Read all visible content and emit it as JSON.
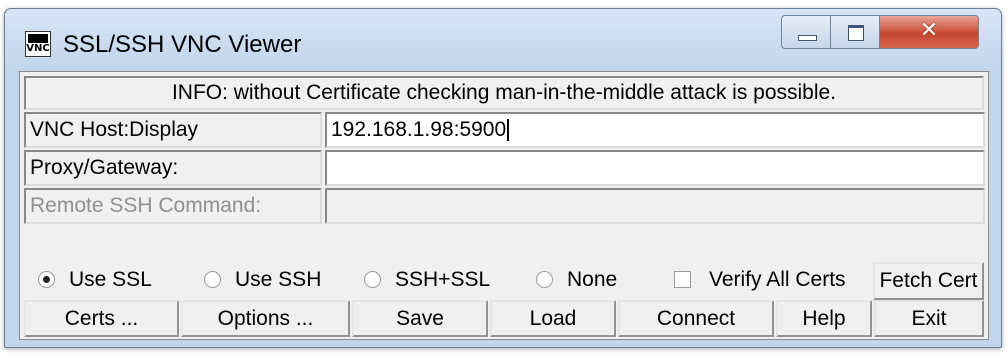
{
  "window": {
    "title": "SSL/SSH VNC Viewer",
    "icon_text": "VNC",
    "close_glyph": "✕"
  },
  "info": "INFO: without Certificate checking man-in-the-middle attack is possible.",
  "fields": {
    "host_label": "VNC Host:Display",
    "host_value": "192.168.1.98:5900",
    "proxy_label": "Proxy/Gateway:",
    "proxy_value": "",
    "remote_cmd_label": "Remote SSH Command:",
    "remote_cmd_value": ""
  },
  "mode": {
    "options": [
      "Use SSL",
      "Use SSH",
      "SSH+SSL",
      "None"
    ],
    "selected": "Use SSL"
  },
  "verify_all_certs": {
    "label": "Verify All Certs",
    "checked": false
  },
  "fetch_cert_label": "Fetch Cert",
  "buttons": {
    "certs": "Certs ...",
    "options": "Options ...",
    "save": "Save",
    "load": "Load",
    "connect": "Connect",
    "help": "Help",
    "exit": "Exit"
  },
  "colors": {
    "titlebar": "#c2d5ec",
    "close_button": "#c7472f"
  }
}
